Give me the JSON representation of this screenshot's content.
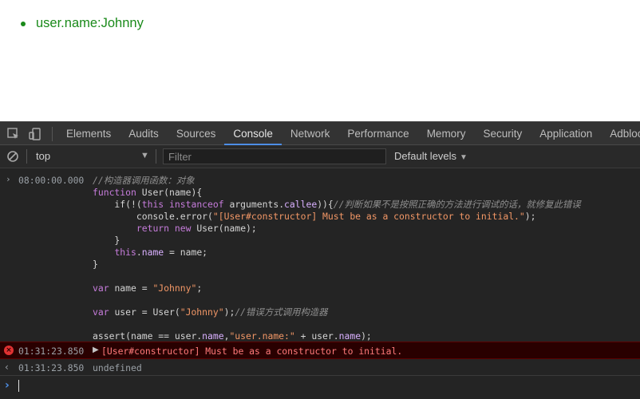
{
  "page": {
    "list_items": [
      "user.name:Johnny"
    ],
    "text_color": "#1a8a1a"
  },
  "devtools": {
    "tabs": [
      "Elements",
      "Audits",
      "Sources",
      "Console",
      "Network",
      "Performance",
      "Memory",
      "Security",
      "Application",
      "Adblock P"
    ],
    "active_tab": "Console",
    "accent_color": "#4d8ee6",
    "filterbar": {
      "context": "top",
      "filter_placeholder": "Filter",
      "levels": "Default levels"
    },
    "console": {
      "input_entry": {
        "timestamp": "08:00:00.000",
        "lines": [
          [
            [
              "cmt",
              "//构造器调用函数：对象"
            ]
          ],
          [
            [
              "kw",
              "function "
            ],
            [
              "fn",
              "User"
            ],
            [
              "fn",
              "(name){"
            ]
          ],
          [
            [
              "fn",
              "    if(!("
            ],
            [
              "kw",
              "this "
            ],
            [
              "kw",
              "instanceof "
            ],
            [
              "fn",
              "arguments."
            ],
            [
              "prop",
              "callee"
            ],
            [
              "fn",
              ")){"
            ],
            [
              "cmt",
              "//判断如果不是按照正确的方法进行调试的话，就修复此错误"
            ]
          ],
          [
            [
              "fn",
              "        console.error("
            ],
            [
              "str",
              "\"[User#constructor] Must be as a constructor to initial.\""
            ],
            [
              "fn",
              ");"
            ]
          ],
          [
            [
              "fn",
              "        "
            ],
            [
              "kw",
              "return "
            ],
            [
              "kw",
              "new "
            ],
            [
              "fn",
              "User(name);"
            ]
          ],
          [
            [
              "fn",
              "    }"
            ]
          ],
          [
            [
              "fn",
              "    "
            ],
            [
              "kw",
              "this"
            ],
            [
              "fn",
              "."
            ],
            [
              "prop",
              "name"
            ],
            [
              "fn",
              " = name;"
            ]
          ],
          [
            [
              "fn",
              "}"
            ]
          ],
          [
            [
              "fn",
              ""
            ]
          ],
          [
            [
              "kw",
              "var "
            ],
            [
              "fn",
              "name = "
            ],
            [
              "str",
              "\"Johnny\""
            ],
            [
              "fn",
              ";"
            ]
          ],
          [
            [
              "fn",
              ""
            ]
          ],
          [
            [
              "kw",
              "var "
            ],
            [
              "fn",
              "user = User("
            ],
            [
              "str",
              "\"Johnny\""
            ],
            [
              "fn",
              ");"
            ],
            [
              "cmt",
              "//错误方式调用构造器"
            ]
          ],
          [
            [
              "fn",
              ""
            ]
          ],
          [
            [
              "fn",
              "assert(name == user."
            ],
            [
              "prop",
              "name"
            ],
            [
              "fn",
              ","
            ],
            [
              "str",
              "\"user.name:\""
            ],
            [
              "fn",
              " + user."
            ],
            [
              "prop",
              "name"
            ],
            [
              "fn",
              ");"
            ]
          ]
        ]
      },
      "error_entry": {
        "timestamp": "01:31:23.850",
        "message": "[User#constructor] Must be as a constructor to initial."
      },
      "result_entry": {
        "timestamp": "01:31:23.850",
        "value": "undefined"
      }
    }
  }
}
